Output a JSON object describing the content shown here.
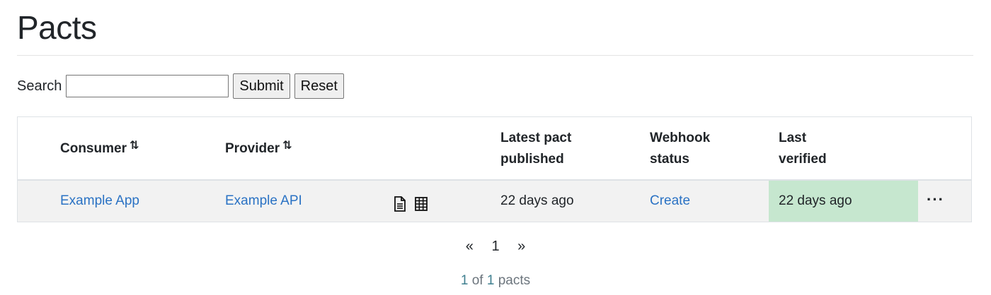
{
  "page": {
    "title": "Pacts"
  },
  "search": {
    "label": "Search",
    "value": "",
    "placeholder": "",
    "submit_label": "Submit",
    "reset_label": "Reset"
  },
  "table": {
    "headers": {
      "consumer": "Consumer",
      "provider": "Provider",
      "latest_line1": "Latest pact",
      "latest_line2": "published",
      "webhook_line1": "Webhook",
      "webhook_line2": "status",
      "verified_line1": "Last",
      "verified_line2": "verified",
      "sort_icon": "⇅"
    },
    "rows": [
      {
        "consumer": "Example App",
        "provider": "Example API",
        "latest_published": "22 days ago",
        "webhook": "Create",
        "last_verified": "22 days ago",
        "verified_color": "#c6e7cf",
        "more": "···"
      }
    ]
  },
  "pagination": {
    "prev": "«",
    "current": "1",
    "next": "»"
  },
  "summary": {
    "current": "1",
    "of_text": "of",
    "total": "1",
    "unit": "pacts"
  },
  "colors": {
    "link": "#2a72c4",
    "row_bg": "#f2f2f2",
    "success": "#c6e7cf"
  }
}
